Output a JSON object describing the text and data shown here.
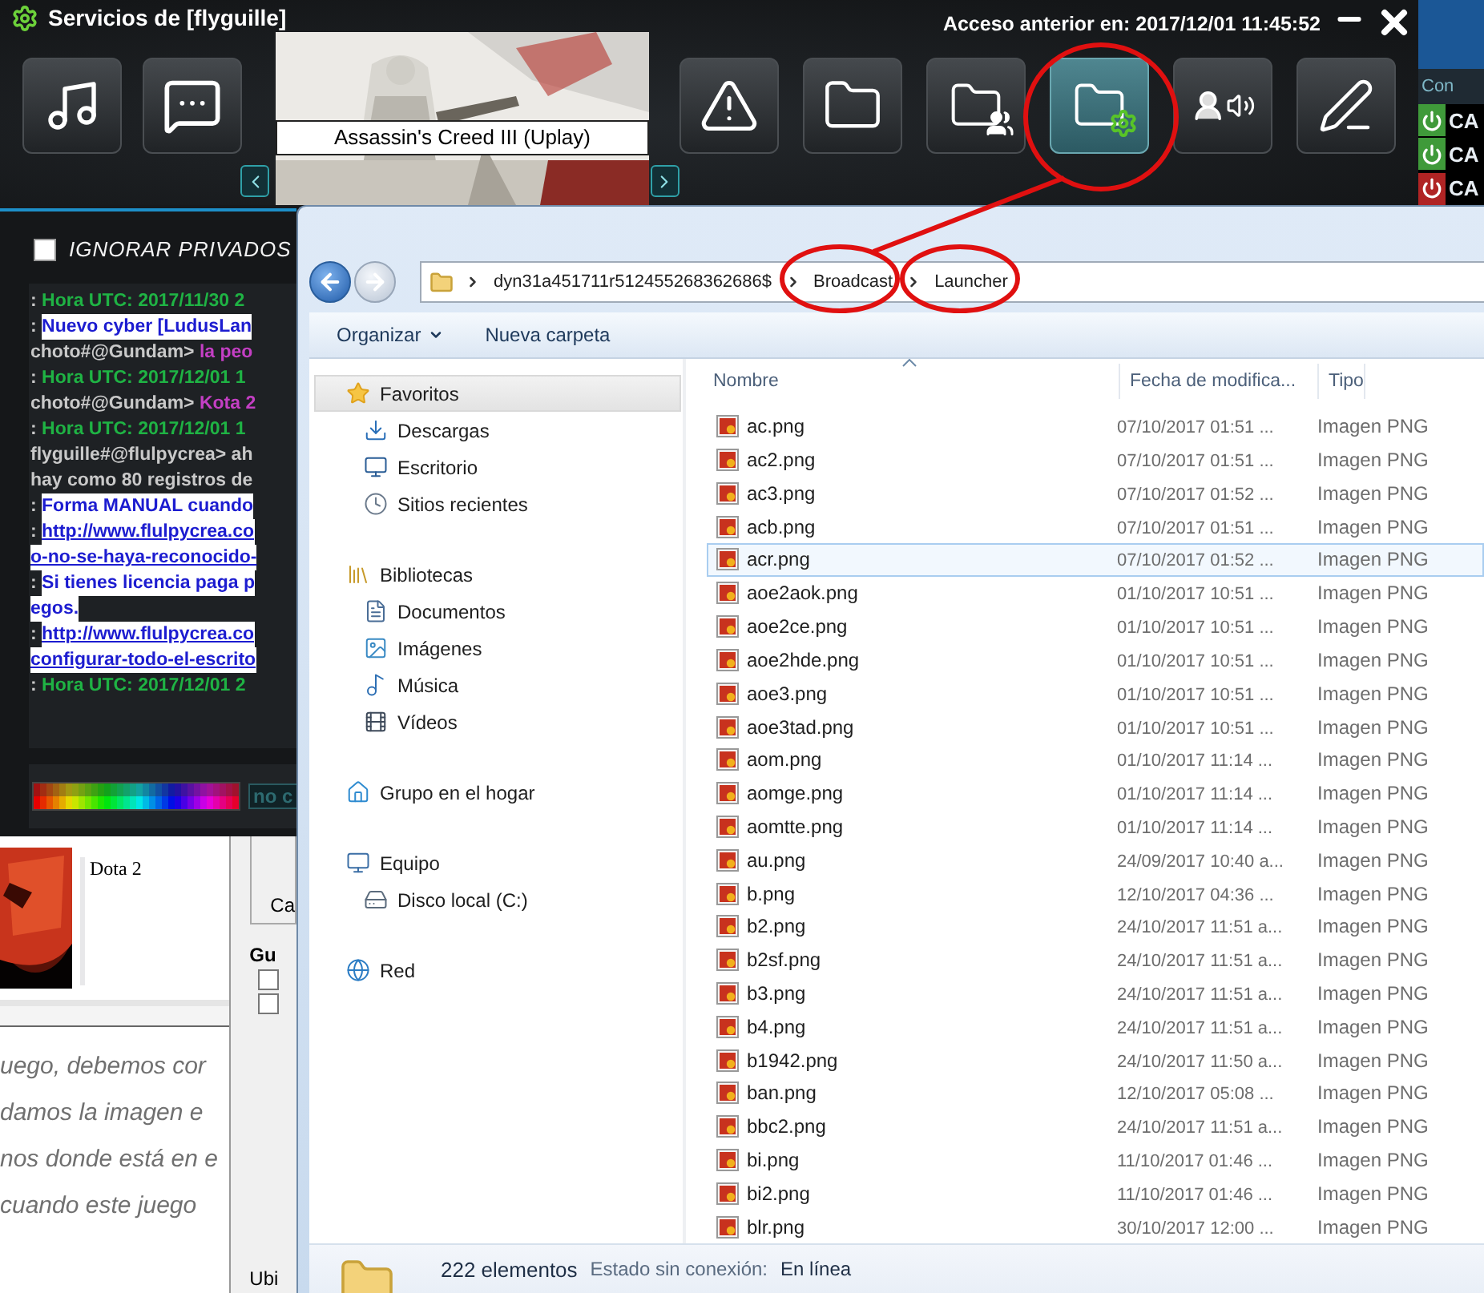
{
  "app": {
    "title": "Servicios de [flyguille]",
    "last_access": "Acceso anterior en: 2017/12/01 11:45:52"
  },
  "toolbar_left": [
    {
      "kind": "music",
      "selected": false
    },
    {
      "kind": "chat",
      "selected": false
    }
  ],
  "toolbar_right": [
    {
      "kind": "warning",
      "selected": false
    },
    {
      "kind": "folder",
      "selected": false
    },
    {
      "kind": "folder_users",
      "selected": false
    },
    {
      "kind": "folder_update",
      "selected": true
    },
    {
      "kind": "user_voice",
      "selected": false
    },
    {
      "kind": "edit",
      "selected": false
    }
  ],
  "game_banner": {
    "caption": "Assassin's Creed III (Uplay)"
  },
  "side_panel": {
    "header": "Con",
    "rows": [
      {
        "label": "CA",
        "on": true
      },
      {
        "label": "CA",
        "on": true
      },
      {
        "label": "CA",
        "on": false
      }
    ]
  },
  "chat": {
    "ignore_private": {
      "label": "IGNORAR PRIVADOS",
      "checked": false
    },
    "lines": [
      {
        "segments": [
          {
            "kind": "plain",
            "text": ": "
          },
          {
            "kind": "utc",
            "text": "Hora UTC: 2017/11/30 2"
          }
        ]
      },
      {
        "segments": [
          {
            "kind": "plain",
            "text": ": "
          },
          {
            "kind": "notice",
            "text": "Nuevo cyber [LudusLan"
          }
        ]
      },
      {
        "segments": [
          {
            "kind": "plain",
            "text": "choto#@Gundam> "
          },
          {
            "kind": "magenta",
            "text": "la peo"
          }
        ]
      },
      {
        "segments": [
          {
            "kind": "plain",
            "text": ": "
          },
          {
            "kind": "utc",
            "text": "Hora UTC: 2017/12/01 1"
          }
        ]
      },
      {
        "segments": [
          {
            "kind": "plain",
            "text": "choto#@Gundam> "
          },
          {
            "kind": "magenta",
            "text": "Kota 2"
          }
        ]
      },
      {
        "segments": [
          {
            "kind": "plain",
            "text": ": "
          },
          {
            "kind": "utc",
            "text": "Hora UTC: 2017/12/01 1"
          }
        ]
      },
      {
        "segments": [
          {
            "kind": "plain",
            "text": "flyguille#@flulpycrea> ah"
          }
        ]
      },
      {
        "segments": [
          {
            "kind": "plain",
            "text": "hay como 80 registros de"
          }
        ]
      },
      {
        "segments": [
          {
            "kind": "plain",
            "text": ": "
          },
          {
            "kind": "notice",
            "text": "Forma MANUAL cuando"
          }
        ]
      },
      {
        "segments": [
          {
            "kind": "plain",
            "text": ": "
          },
          {
            "kind": "link",
            "text": "http://www.flulpycrea.co"
          }
        ]
      },
      {
        "segments": [
          {
            "kind": "link",
            "text": "o-no-se-haya-reconocido-"
          }
        ]
      },
      {
        "segments": [
          {
            "kind": "plain",
            "text": ": "
          },
          {
            "kind": "notice",
            "text": "Si tienes licencia paga p"
          }
        ]
      },
      {
        "segments": [
          {
            "kind": "notice",
            "text": "egos."
          }
        ]
      },
      {
        "segments": [
          {
            "kind": "plain",
            "text": ": "
          },
          {
            "kind": "link",
            "text": "http://www.flulpycrea.co"
          }
        ]
      },
      {
        "segments": [
          {
            "kind": "link",
            "text": "configurar-todo-el-escrito"
          }
        ]
      },
      {
        "segments": [
          {
            "kind": "plain",
            "text": ": "
          },
          {
            "kind": "utc",
            "text": "Hora UTC: 2017/12/01 2"
          }
        ]
      }
    ],
    "color_input": {
      "value": "no c"
    }
  },
  "game_list": {
    "item": "Dota 2"
  },
  "options": {
    "button": "Ca",
    "group": "Gu",
    "checkboxes": [
      {
        "checked": false
      },
      {
        "checked": false
      }
    ],
    "footer_label": "Ubi"
  },
  "article": {
    "lines": [
      "uego, debemos cor",
      "damos la imagen e",
      "nos donde está en e",
      "cuando este juego"
    ]
  },
  "explorer": {
    "path": [
      "dyn31a451711r512455268362686$",
      "Broadcast",
      "Launcher"
    ],
    "commands": [
      {
        "label": "Organizar",
        "dropdown": true
      },
      {
        "label": "Nueva carpeta",
        "dropdown": false
      }
    ],
    "nav_pane": [
      {
        "label": "Favoritos",
        "kind": "favorites",
        "selected": true,
        "children": [
          {
            "label": "Descargas",
            "kind": "downloads",
            "selected": false
          },
          {
            "label": "Escritorio",
            "kind": "desktop",
            "selected": false
          },
          {
            "label": "Sitios recientes",
            "kind": "recent",
            "selected": false
          }
        ]
      },
      {
        "label": "Bibliotecas",
        "kind": "libraries",
        "selected": false,
        "children": [
          {
            "label": "Documentos",
            "kind": "documents",
            "selected": false
          },
          {
            "label": "Imágenes",
            "kind": "pictures",
            "selected": false
          },
          {
            "label": "Música",
            "kind": "music",
            "selected": false
          },
          {
            "label": "Vídeos",
            "kind": "videos",
            "selected": false
          }
        ]
      },
      {
        "label": "Grupo en el hogar",
        "kind": "homegroup",
        "selected": false
      },
      {
        "label": "Equipo",
        "kind": "computer",
        "selected": false,
        "children": [
          {
            "label": "Disco local (C:)",
            "kind": "drive",
            "selected": false
          }
        ]
      },
      {
        "label": "Red",
        "kind": "network",
        "selected": false
      }
    ],
    "columns": [
      {
        "label": "Nombre",
        "sorted": true
      },
      {
        "label": "Fecha de modifica...",
        "sorted": false
      },
      {
        "label": "Tipo",
        "sorted": false
      }
    ],
    "files": [
      {
        "name": "ac.png",
        "modified": "07/10/2017 01:51 ...",
        "type": "Imagen PNG",
        "selected": false
      },
      {
        "name": "ac2.png",
        "modified": "07/10/2017 01:51 ...",
        "type": "Imagen PNG",
        "selected": false
      },
      {
        "name": "ac3.png",
        "modified": "07/10/2017 01:52 ...",
        "type": "Imagen PNG",
        "selected": false
      },
      {
        "name": "acb.png",
        "modified": "07/10/2017 01:51 ...",
        "type": "Imagen PNG",
        "selected": false
      },
      {
        "name": "acr.png",
        "modified": "07/10/2017 01:52 ...",
        "type": "Imagen PNG",
        "selected": true
      },
      {
        "name": "aoe2aok.png",
        "modified": "01/10/2017 10:51 ...",
        "type": "Imagen PNG",
        "selected": false
      },
      {
        "name": "aoe2ce.png",
        "modified": "01/10/2017 10:51 ...",
        "type": "Imagen PNG",
        "selected": false
      },
      {
        "name": "aoe2hde.png",
        "modified": "01/10/2017 10:51 ...",
        "type": "Imagen PNG",
        "selected": false
      },
      {
        "name": "aoe3.png",
        "modified": "01/10/2017 10:51 ...",
        "type": "Imagen PNG",
        "selected": false
      },
      {
        "name": "aoe3tad.png",
        "modified": "01/10/2017 10:51 ...",
        "type": "Imagen PNG",
        "selected": false
      },
      {
        "name": "aom.png",
        "modified": "01/10/2017 11:14 ...",
        "type": "Imagen PNG",
        "selected": false
      },
      {
        "name": "aomge.png",
        "modified": "01/10/2017 11:14 ...",
        "type": "Imagen PNG",
        "selected": false
      },
      {
        "name": "aomtte.png",
        "modified": "01/10/2017 11:14 ...",
        "type": "Imagen PNG",
        "selected": false
      },
      {
        "name": "au.png",
        "modified": "24/09/2017 10:40 a...",
        "type": "Imagen PNG",
        "selected": false
      },
      {
        "name": "b.png",
        "modified": "12/10/2017 04:36 ...",
        "type": "Imagen PNG",
        "selected": false
      },
      {
        "name": "b2.png",
        "modified": "24/10/2017 11:51 a...",
        "type": "Imagen PNG",
        "selected": false
      },
      {
        "name": "b2sf.png",
        "modified": "24/10/2017 11:51 a...",
        "type": "Imagen PNG",
        "selected": false
      },
      {
        "name": "b3.png",
        "modified": "24/10/2017 11:51 a...",
        "type": "Imagen PNG",
        "selected": false
      },
      {
        "name": "b4.png",
        "modified": "24/10/2017 11:51 a...",
        "type": "Imagen PNG",
        "selected": false
      },
      {
        "name": "b1942.png",
        "modified": "24/10/2017 11:50 a...",
        "type": "Imagen PNG",
        "selected": false
      },
      {
        "name": "ban.png",
        "modified": "12/10/2017 05:08 ...",
        "type": "Imagen PNG",
        "selected": false
      },
      {
        "name": "bbc2.png",
        "modified": "24/10/2017 11:51 a...",
        "type": "Imagen PNG",
        "selected": false
      },
      {
        "name": "bi.png",
        "modified": "11/10/2017 01:46 ...",
        "type": "Imagen PNG",
        "selected": false
      },
      {
        "name": "bi2.png",
        "modified": "11/10/2017 01:46 ...",
        "type": "Imagen PNG",
        "selected": false
      },
      {
        "name": "blr.png",
        "modified": "30/10/2017 12:00 ...",
        "type": "Imagen PNG",
        "selected": false
      }
    ],
    "status": {
      "count": "222 elementos",
      "offline_label": "Estado sin conexión:",
      "offline_value": "En línea"
    }
  }
}
